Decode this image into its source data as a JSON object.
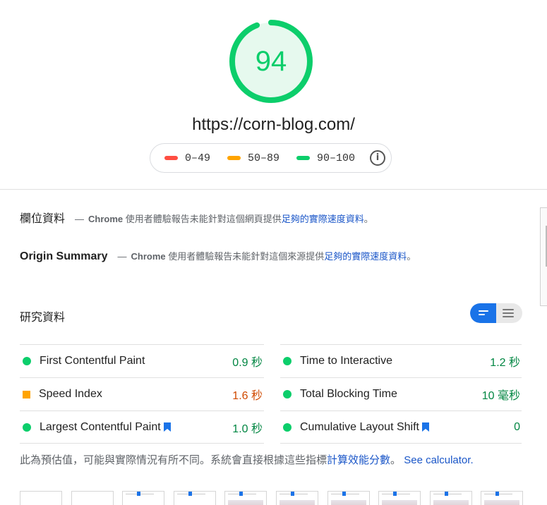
{
  "score": {
    "value": "94",
    "fraction": 0.94,
    "color": "#0cce6b",
    "bg": "#e6f9ee"
  },
  "url": "https://corn-blog.com/",
  "legend": [
    {
      "label": "0–49",
      "color": "#ff4e42"
    },
    {
      "label": "50–89",
      "color": "#ffa400"
    },
    {
      "label": "90–100",
      "color": "#0cce6b"
    }
  ],
  "legend_info_icon": "info-icon",
  "field_data": {
    "title": "欄位資料",
    "dash": "—",
    "chrome": "Chrome",
    "text": " 使用者體驗報告未能針對這個網頁提供",
    "link": "足夠的實際速度資料",
    "end": "。"
  },
  "origin_summary": {
    "title": "Origin Summary",
    "dash": "—",
    "chrome": "Chrome",
    "text": " 使用者體驗報告未能針對這個來源提供",
    "link": "足夠的實際速度資料",
    "end": "。"
  },
  "lab_data": {
    "title": "研究資料"
  },
  "metrics_left": [
    {
      "name": "First Contentful Paint",
      "value": "0.9 秒",
      "status": "pass",
      "bookmark": false
    },
    {
      "name": "Speed Index",
      "value": "1.6 秒",
      "status": "average",
      "bookmark": false
    },
    {
      "name": "Largest Contentful Paint",
      "value": "1.0 秒",
      "status": "pass",
      "bookmark": true
    }
  ],
  "metrics_right": [
    {
      "name": "Time to Interactive",
      "value": "1.2 秒",
      "status": "pass",
      "bookmark": false
    },
    {
      "name": "Total Blocking Time",
      "value": "10 毫秒",
      "status": "pass",
      "bookmark": false
    },
    {
      "name": "Cumulative Layout Shift",
      "value": "0",
      "status": "pass",
      "bookmark": true
    }
  ],
  "footnote": {
    "text": "此為預估值，可能與實際情況有所不同。系統會直接根據這些指標",
    "link": "計算效能分數",
    "end": "。",
    "calc": "See calculator."
  },
  "filmstrip": {
    "frames": 10
  }
}
